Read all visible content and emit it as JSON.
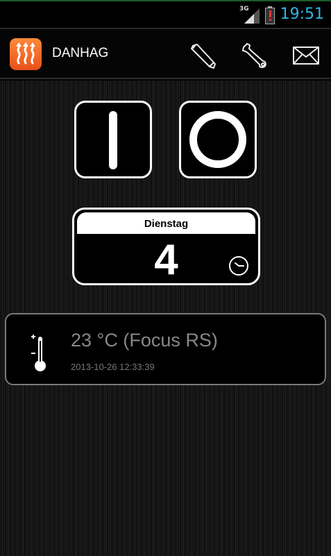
{
  "status_bar": {
    "network_type": "3G",
    "time": "19:51",
    "icons": {
      "signal": "signal-icon",
      "battery": "battery-alert-icon"
    },
    "colors": {
      "time": "#33b5e5",
      "battery_alert": "#e53935"
    }
  },
  "action_bar": {
    "title": "DANHAG",
    "app_icon": "heater-icon",
    "actions": [
      {
        "name": "edit",
        "icon": "pencil-icon"
      },
      {
        "name": "settings",
        "icon": "wrench-icon"
      },
      {
        "name": "messages",
        "icon": "mail-icon"
      }
    ],
    "colors": {
      "app_icon_top": "#ff8a3a",
      "app_icon_bottom": "#e8501a"
    }
  },
  "controls": {
    "power_on_icon": "power-on-icon",
    "power_off_icon": "power-off-icon"
  },
  "timer": {
    "day": "Dienstag",
    "value": "4",
    "icon": "clock-icon"
  },
  "sensor": {
    "reading": "23 °C (Focus RS)",
    "timestamp": "2013-10-26 12:33:39",
    "icon": "thermometer-icon"
  }
}
